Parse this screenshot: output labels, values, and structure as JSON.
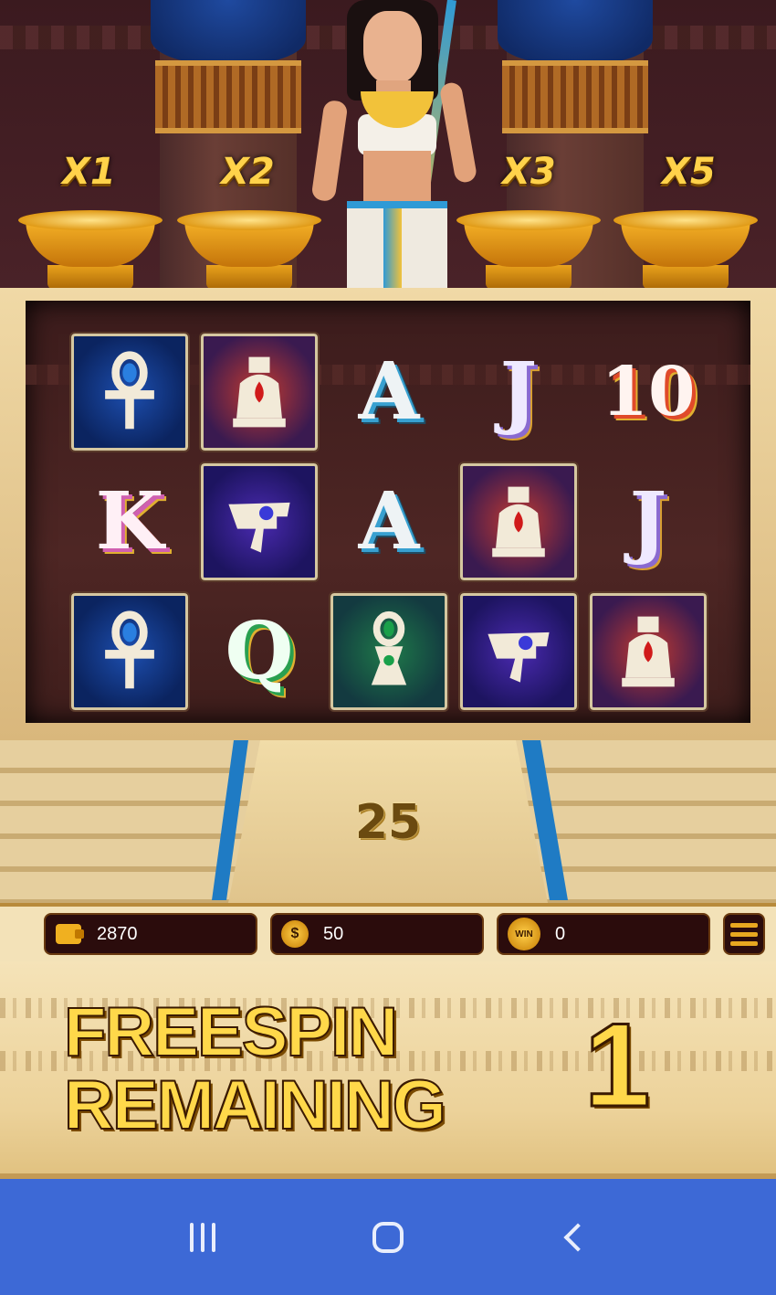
{
  "multipliers": [
    "X1",
    "X2",
    "X3",
    "X5"
  ],
  "reels": [
    [
      {
        "symbol": "ankh",
        "frame": "blue"
      },
      {
        "symbol": "vase",
        "frame": "red"
      },
      {
        "symbol": "A",
        "text": "A",
        "class": "letterA"
      },
      {
        "symbol": "J",
        "text": "J",
        "class": "letterJ"
      },
      {
        "symbol": "10",
        "text": "10",
        "class": "letter10"
      }
    ],
    [
      {
        "symbol": "K",
        "text": "K",
        "class": "letterK"
      },
      {
        "symbol": "eye-of-horus",
        "frame": "purple"
      },
      {
        "symbol": "A",
        "text": "A",
        "class": "letterA"
      },
      {
        "symbol": "vase",
        "frame": "red"
      },
      {
        "symbol": "J",
        "text": "J",
        "class": "letterJ"
      }
    ],
    [
      {
        "symbol": "ankh",
        "frame": "blue"
      },
      {
        "symbol": "Q",
        "text": "Q",
        "class": "letterQ"
      },
      {
        "symbol": "amulet",
        "frame": "green"
      },
      {
        "symbol": "eye-of-horus",
        "frame": "purple"
      },
      {
        "symbol": "vase",
        "frame": "red"
      }
    ]
  ],
  "bet_display": "25",
  "hud": {
    "balance": "2870",
    "bet": "50",
    "win_label": "WIN",
    "win": "0",
    "coin_symbol": "$"
  },
  "freespin": {
    "line1": "FREESPIN",
    "line2": "REMAINING",
    "count": "1"
  },
  "colors": {
    "gold": "#ffd84a",
    "nav_bar": "#3d69d6",
    "hud_pill": "#2b0c0c"
  },
  "icons": {
    "wallet": "wallet-icon",
    "coin": "coin-icon",
    "win": "win-icon",
    "menu": "menu-icon",
    "recents": "recents-icon",
    "home": "home-icon",
    "back": "back-icon"
  }
}
